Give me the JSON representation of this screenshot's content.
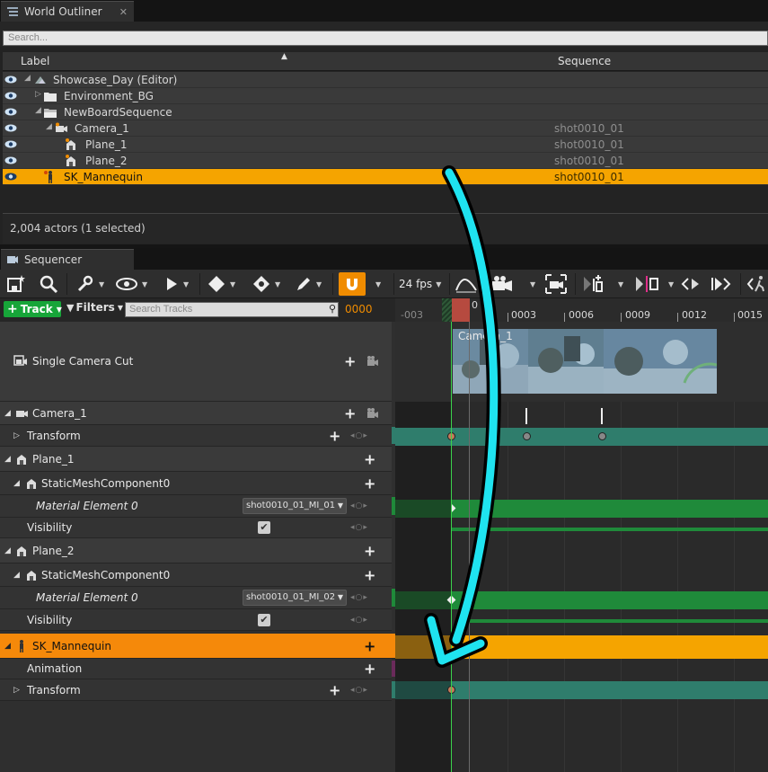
{
  "outliner": {
    "tab_title": "World Outliner",
    "tab_close": "✕",
    "search_placeholder": "Search...",
    "columns": {
      "label": "Label",
      "sequence": "Sequence"
    },
    "rows": [
      {
        "name": "Showcase_Day (Editor)",
        "sequence": "",
        "icon": "world-icon",
        "expander": "◢",
        "selected": false
      },
      {
        "name": "Environment_BG",
        "sequence": "",
        "icon": "folder-icon",
        "expander": "▷",
        "selected": false
      },
      {
        "name": "NewBoardSequence",
        "sequence": "",
        "icon": "folder-open-icon",
        "expander": "◢",
        "selected": false
      },
      {
        "name": "Camera_1",
        "sequence": "shot0010_01",
        "icon": "camera-icon",
        "expander": "◢",
        "selected": false
      },
      {
        "name": "Plane_1",
        "sequence": "shot0010_01",
        "icon": "static-mesh-icon",
        "expander": "",
        "selected": false
      },
      {
        "name": "Plane_2",
        "sequence": "shot0010_01",
        "icon": "static-mesh-icon",
        "expander": "",
        "selected": false
      },
      {
        "name": "SK_Mannequin",
        "sequence": "shot0010_01",
        "icon": "skeletal-mesh-icon",
        "expander": "",
        "selected": true
      }
    ],
    "status": "2,004 actors (1 selected)"
  },
  "sequencer": {
    "tab_title": "Sequencer",
    "toolbar": {
      "fps": "24 fps",
      "icons": [
        "save-icon",
        "search-icon",
        "wrench-icon",
        "eye-icon",
        "play-icon",
        "key-icon",
        "transform-key-icon",
        "pencil-icon",
        "magnet-icon",
        "curve-editor-icon",
        "camera-add-icon",
        "camera-lock-icon",
        "jump-start-icon",
        "range-icon",
        "step-back-icon",
        "step-forward-icon",
        "walk-icon"
      ]
    },
    "track_button": "Track",
    "filters_button": "Filters",
    "search_placeholder": "Search Tracks",
    "current_frame": "0000",
    "ruler_labels": [
      "-003",
      "0",
      "0003",
      "0006",
      "0009",
      "0012",
      "0015"
    ],
    "tracks": [
      {
        "name": "Single Camera Cut",
        "kind": "camera-cut"
      },
      {
        "name": "Camera_1",
        "kind": "object"
      },
      {
        "name": "Transform",
        "kind": "property"
      },
      {
        "name": "Plane_1",
        "kind": "object"
      },
      {
        "name": "StaticMeshComponent0",
        "kind": "component"
      },
      {
        "name": "Material Element 0",
        "kind": "material",
        "value": "shot0010_01_MI_01"
      },
      {
        "name": "Visibility",
        "kind": "bool",
        "checked": true
      },
      {
        "name": "Plane_2",
        "kind": "object"
      },
      {
        "name": "StaticMeshComponent0",
        "kind": "component"
      },
      {
        "name": "Material Element 0",
        "kind": "material",
        "value": "shot0010_01_MI_02"
      },
      {
        "name": "Visibility",
        "kind": "bool",
        "checked": true
      },
      {
        "name": "SK_Mannequin",
        "kind": "object",
        "selected": true
      },
      {
        "name": "Animation",
        "kind": "property"
      },
      {
        "name": "Transform",
        "kind": "property"
      }
    ],
    "camera_thumb_label": "Camera_1",
    "colors": {
      "accent": "#f08c00",
      "selection": "#f5a400",
      "transform_lane": "#2f7d6c",
      "material_lane": "#1f8a3a",
      "anim_lane": "#f5a400",
      "arrow": "#1fe3f0"
    }
  }
}
